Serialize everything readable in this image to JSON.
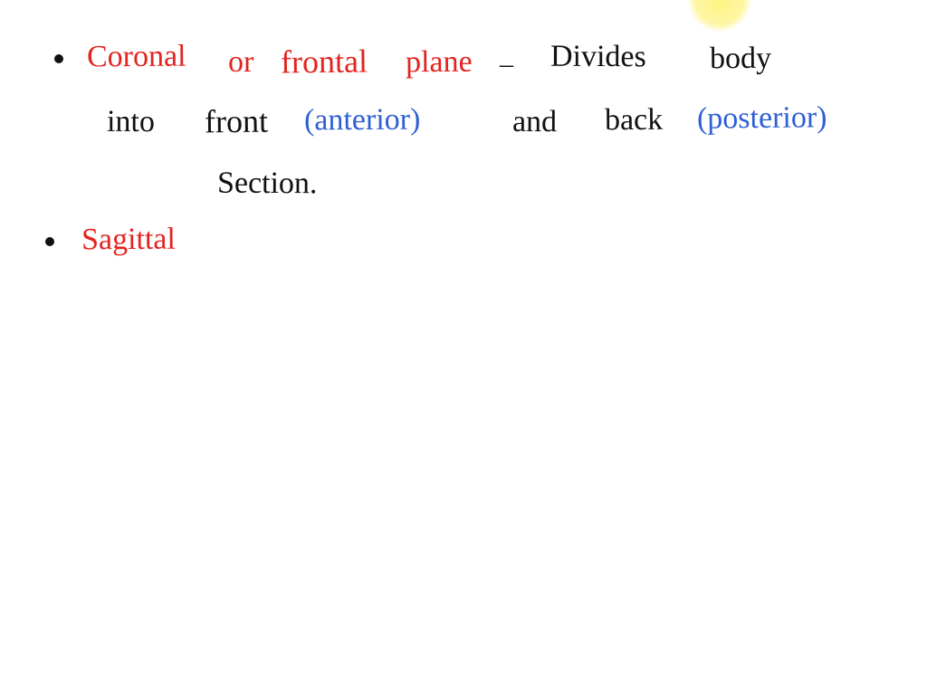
{
  "highlight": {
    "present": true
  },
  "bullets": {
    "b1": {
      "item1": {
        "term_part1": "Coronal",
        "term_part2": "or",
        "term_part3": "frontal",
        "term_part4": "plane",
        "dash": "–",
        "def_part1": "Divides",
        "def_part2": "body",
        "def_part3": "into",
        "def_part4": "front",
        "paren1": "(anterior)",
        "def_part5": "and",
        "def_part6": "back",
        "paren2": "(posterior)",
        "def_part7": "Section."
      }
    },
    "b2": {
      "item2": {
        "term": "Sagittal"
      }
    }
  }
}
